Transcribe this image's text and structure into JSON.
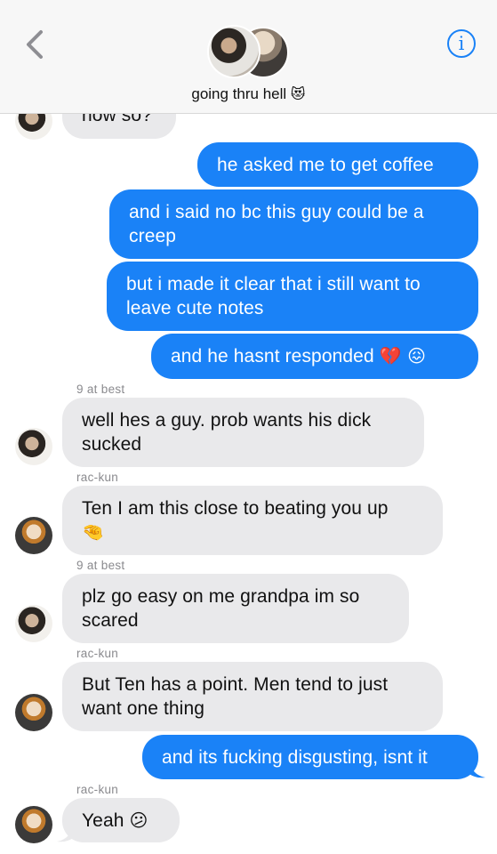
{
  "header": {
    "group_name": "going thru hell",
    "group_emoji": "😻",
    "info_label": "i"
  },
  "messages": [
    {
      "text": "how so?",
      "sender": ""
    },
    {
      "text": "he asked me to get coffee"
    },
    {
      "text": "and i said no bc this guy could be a creep"
    },
    {
      "text": "but i made it clear that i still want to leave cute notes"
    },
    {
      "text": "and he hasnt responded",
      "emoji": "💔 😖"
    },
    {
      "sender": "9 at best",
      "text": "well hes a guy. prob wants his dick sucked"
    },
    {
      "sender": "rac-kun",
      "text": "Ten I am this close to beating you up",
      "emoji": "🤏"
    },
    {
      "sender": "9 at best",
      "text": "plz go easy on me grandpa im so scared"
    },
    {
      "sender": "rac-kun",
      "text": "But Ten has a point. Men tend to just want one thing"
    },
    {
      "text": "and its fucking disgusting, isnt it"
    },
    {
      "sender": "rac-kun",
      "text": "Yeah",
      "emoji": "😕"
    }
  ],
  "colors": {
    "outgoing": "#1a82f7",
    "incoming": "#e9e9eb",
    "accent": "#1a82f7"
  },
  "icons": {
    "back": "chevron-left-icon",
    "info": "info-circle-icon"
  }
}
